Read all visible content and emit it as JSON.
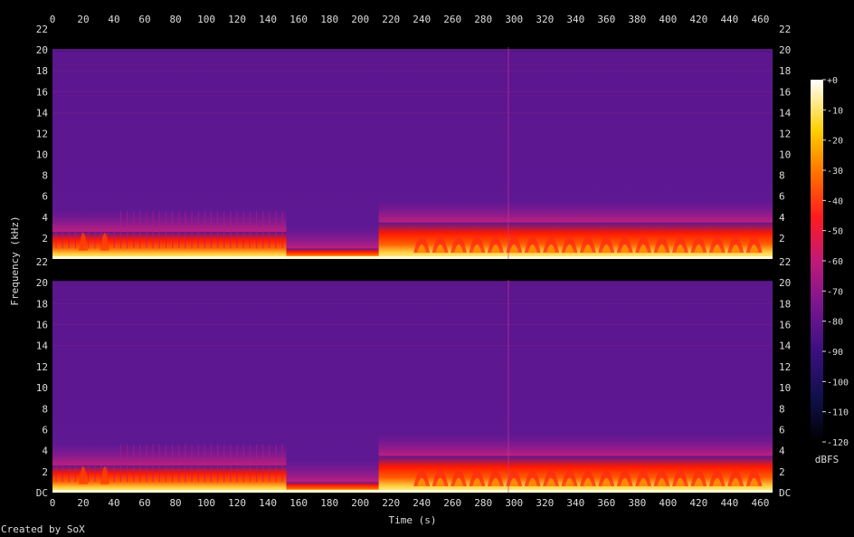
{
  "chart_data": {
    "type": "heatmap",
    "title": "",
    "xlabel": "Time (s)",
    "ylabel": "Frequency (kHz)",
    "x_ticks": [
      0,
      20,
      40,
      60,
      80,
      100,
      120,
      140,
      160,
      180,
      200,
      220,
      240,
      260,
      280,
      300,
      320,
      340,
      360,
      380,
      400,
      420,
      440,
      460
    ],
    "xlim": [
      0,
      468
    ],
    "y_ticks": [
      2,
      4,
      6,
      8,
      10,
      12,
      14,
      16,
      18,
      20,
      22
    ],
    "y_bottom_label": "DC",
    "ylim_khz": [
      0,
      22
    ],
    "channels": 2,
    "colorbar": {
      "label": "dBFS",
      "ticks": [
        "+0",
        "-10",
        "-20",
        "-30",
        "-40",
        "-50",
        "-60",
        "-70",
        "-80",
        "-90",
        "-100",
        "-110",
        "-120"
      ],
      "range_db": [
        -120,
        0
      ]
    },
    "segments": [
      {
        "start_s": 0,
        "end_s": 152,
        "energy_top_khz": 2.6
      },
      {
        "start_s": 152,
        "end_s": 212,
        "energy_top_khz": 1.0
      },
      {
        "start_s": 212,
        "end_s": 468,
        "energy_top_khz": 3.5
      }
    ],
    "vertical_line_s": 296
  },
  "footer": {
    "credit": "Created by SoX"
  },
  "colors": {
    "background": "#000000",
    "floor": "#5a148c",
    "mid": "#c81e78",
    "hot": "#ff2000",
    "peak": "#ffffc8"
  }
}
